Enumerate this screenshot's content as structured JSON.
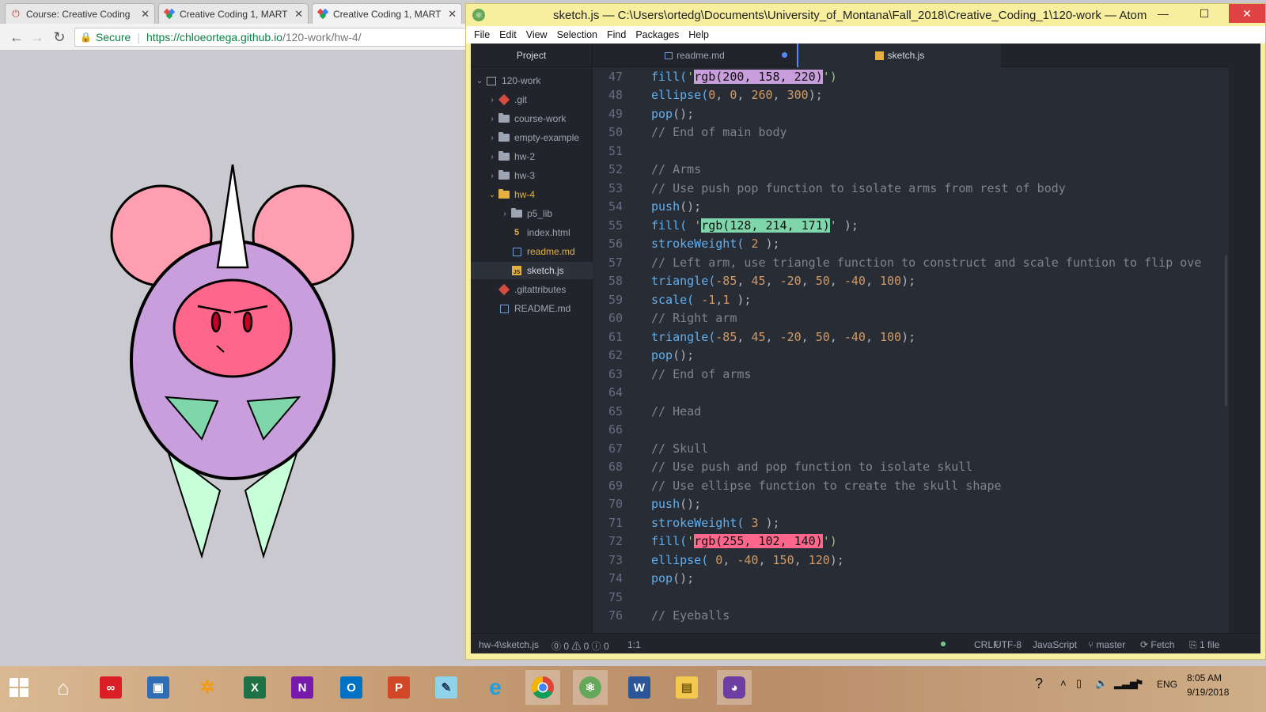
{
  "browser": {
    "tabs": [
      {
        "title": "Course: Creative Coding",
        "favicon": "power-icon"
      },
      {
        "title": "Creative Coding 1, MART",
        "favicon": "github-pages-icon"
      },
      {
        "title": "Creative Coding 1, MART",
        "favicon": "github-pages-icon"
      }
    ],
    "secure_label": "Secure",
    "url_host": "https://chloeortega.github.io",
    "url_path": "/120-work/hw-4/",
    "canvas_bg": "#c9c9cf"
  },
  "atom": {
    "title": "sketch.js — C:\\Users\\ortedg\\Documents\\University_of_Montana\\Fall_2018\\Creative_Coding_1\\120-work — Atom",
    "menu": [
      "File",
      "Edit",
      "View",
      "Selection",
      "Find",
      "Packages",
      "Help"
    ],
    "tree": {
      "header": "Project",
      "root": "120-work",
      "items": [
        {
          "label": ".git",
          "kind": "git",
          "color": "#9da5b4"
        },
        {
          "label": "course-work",
          "kind": "folder"
        },
        {
          "label": "empty-example",
          "kind": "folder"
        },
        {
          "label": "hw-2",
          "kind": "folder"
        },
        {
          "label": "hw-3",
          "kind": "folder"
        },
        {
          "label": "hw-4",
          "kind": "folder-open"
        },
        {
          "label": "p5_lib",
          "kind": "folder"
        },
        {
          "label": "index.html",
          "kind": "html"
        },
        {
          "label": "readme.md",
          "kind": "md"
        },
        {
          "label": "sketch.js",
          "kind": "js"
        },
        {
          "label": ".gitattributes",
          "kind": "git"
        },
        {
          "label": "README.md",
          "kind": "md"
        }
      ]
    },
    "tabs": [
      {
        "label": "readme.md",
        "modified": true
      },
      {
        "label": "sketch.js",
        "active": true
      }
    ],
    "code": [
      {
        "n": "47",
        "parts": [
          [
            "fn",
            "fill("
          ],
          [
            "str",
            "'"
          ],
          [
            "hl-purple",
            "rgb(200, 158, 220)"
          ],
          [
            "str",
            "')"
          ]
        ]
      },
      {
        "n": "48",
        "parts": [
          [
            "fn",
            "ellipse("
          ],
          [
            "num",
            "0"
          ],
          [
            "txt",
            ", "
          ],
          [
            "num",
            "0"
          ],
          [
            "txt",
            ", "
          ],
          [
            "num",
            "260"
          ],
          [
            "txt",
            ", "
          ],
          [
            "num",
            "300"
          ],
          [
            "txt",
            ");"
          ]
        ]
      },
      {
        "n": "49",
        "parts": [
          [
            "fn",
            "pop"
          ],
          [
            "txt",
            "();"
          ]
        ]
      },
      {
        "n": "50",
        "parts": [
          [
            "com",
            "// End of main body"
          ]
        ]
      },
      {
        "n": "51",
        "parts": []
      },
      {
        "n": "52",
        "parts": [
          [
            "com",
            "// Arms"
          ]
        ]
      },
      {
        "n": "53",
        "parts": [
          [
            "com",
            "// Use push pop function to isolate arms from rest of body"
          ]
        ]
      },
      {
        "n": "54",
        "parts": [
          [
            "fn",
            "push"
          ],
          [
            "txt",
            "();"
          ]
        ]
      },
      {
        "n": "55",
        "parts": [
          [
            "fn",
            "fill("
          ],
          [
            "txt",
            " "
          ],
          [
            "str",
            "'"
          ],
          [
            "hl-green",
            "rgb(128, 214, 171)"
          ],
          [
            "str",
            "'"
          ],
          [
            "txt",
            " );"
          ]
        ]
      },
      {
        "n": "56",
        "parts": [
          [
            "fn",
            "strokeWeight("
          ],
          [
            "txt",
            " "
          ],
          [
            "num",
            "2"
          ],
          [
            "txt",
            " );"
          ]
        ]
      },
      {
        "n": "57",
        "parts": [
          [
            "com",
            "// Left arm, use triangle function to construct and scale funtion to flip ove"
          ]
        ]
      },
      {
        "n": "58",
        "parts": [
          [
            "fn",
            "triangle("
          ],
          [
            "num",
            "-85"
          ],
          [
            "txt",
            ", "
          ],
          [
            "num",
            "45"
          ],
          [
            "txt",
            ", "
          ],
          [
            "num",
            "-20"
          ],
          [
            "txt",
            ", "
          ],
          [
            "num",
            "50"
          ],
          [
            "txt",
            ", "
          ],
          [
            "num",
            "-40"
          ],
          [
            "txt",
            ", "
          ],
          [
            "num",
            "100"
          ],
          [
            "txt",
            ");"
          ]
        ]
      },
      {
        "n": "59",
        "parts": [
          [
            "fn",
            "scale("
          ],
          [
            "txt",
            " "
          ],
          [
            "num",
            "-1"
          ],
          [
            "txt",
            ","
          ],
          [
            "num",
            "1"
          ],
          [
            "txt",
            " );"
          ]
        ]
      },
      {
        "n": "60",
        "parts": [
          [
            "com",
            "// Right arm"
          ]
        ]
      },
      {
        "n": "61",
        "parts": [
          [
            "fn",
            "triangle("
          ],
          [
            "num",
            "-85"
          ],
          [
            "txt",
            ", "
          ],
          [
            "num",
            "45"
          ],
          [
            "txt",
            ", "
          ],
          [
            "num",
            "-20"
          ],
          [
            "txt",
            ", "
          ],
          [
            "num",
            "50"
          ],
          [
            "txt",
            ", "
          ],
          [
            "num",
            "-40"
          ],
          [
            "txt",
            ", "
          ],
          [
            "num",
            "100"
          ],
          [
            "txt",
            ");"
          ]
        ]
      },
      {
        "n": "62",
        "parts": [
          [
            "fn",
            "pop"
          ],
          [
            "txt",
            "();"
          ]
        ]
      },
      {
        "n": "63",
        "parts": [
          [
            "com",
            "// End of arms"
          ]
        ]
      },
      {
        "n": "64",
        "parts": []
      },
      {
        "n": "65",
        "parts": [
          [
            "com",
            "// Head"
          ]
        ]
      },
      {
        "n": "66",
        "parts": []
      },
      {
        "n": "67",
        "parts": [
          [
            "com",
            "// Skull"
          ]
        ]
      },
      {
        "n": "68",
        "parts": [
          [
            "com",
            "// Use push and pop function to isolate skull"
          ]
        ]
      },
      {
        "n": "69",
        "parts": [
          [
            "com",
            "// Use ellipse function to create the skull shape"
          ]
        ]
      },
      {
        "n": "70",
        "parts": [
          [
            "fn",
            "push"
          ],
          [
            "txt",
            "();"
          ]
        ]
      },
      {
        "n": "71",
        "parts": [
          [
            "fn",
            "strokeWeight("
          ],
          [
            "txt",
            " "
          ],
          [
            "num",
            "3"
          ],
          [
            "txt",
            " );"
          ]
        ]
      },
      {
        "n": "72",
        "parts": [
          [
            "fn",
            "fill("
          ],
          [
            "str",
            "'"
          ],
          [
            "hl-pink",
            "rgb(255, 102, 140)"
          ],
          [
            "str",
            "')"
          ]
        ]
      },
      {
        "n": "73",
        "parts": [
          [
            "fn",
            "ellipse("
          ],
          [
            "txt",
            " "
          ],
          [
            "num",
            "0"
          ],
          [
            "txt",
            ", "
          ],
          [
            "num",
            "-40"
          ],
          [
            "txt",
            ", "
          ],
          [
            "num",
            "150"
          ],
          [
            "txt",
            ", "
          ],
          [
            "num",
            "120"
          ],
          [
            "txt",
            ");"
          ]
        ]
      },
      {
        "n": "74",
        "parts": [
          [
            "fn",
            "pop"
          ],
          [
            "txt",
            "();"
          ]
        ]
      },
      {
        "n": "75",
        "parts": []
      },
      {
        "n": "76",
        "parts": [
          [
            "com",
            "// Eyeballs"
          ]
        ]
      }
    ],
    "status": {
      "path": "hw-4\\sketch.js",
      "diagnostics": "⓪ 0 ⚠ 0 ⓘ 0",
      "cursor": "1:1",
      "line_ending": "CRLF",
      "encoding": "UTF-8",
      "grammar": "JavaScript",
      "branch": "master",
      "fetch": "Fetch",
      "changes": "1 file"
    }
  },
  "sketch_colors": {
    "ears": "#ff9eb0",
    "body": "#c89edc",
    "face": "#ff668c",
    "arms": "#80d6ab",
    "legs": "#c6ffd8",
    "horn": "#ffffff"
  },
  "taskbar": {
    "apps": [
      "windows-start-icon",
      "home-icon",
      "adobe-cc-icon",
      "virtualbox-icon",
      "tool-icon",
      "excel-icon",
      "onenote-icon",
      "outlook-icon",
      "powerpoint-icon",
      "notepad-icon",
      "internet-explorer-icon",
      "chrome-icon",
      "atom-icon",
      "word-icon",
      "file-explorer-icon",
      "github-desktop-icon"
    ],
    "language": "ENG",
    "time": "8:05 AM",
    "date": "9/19/2018"
  }
}
